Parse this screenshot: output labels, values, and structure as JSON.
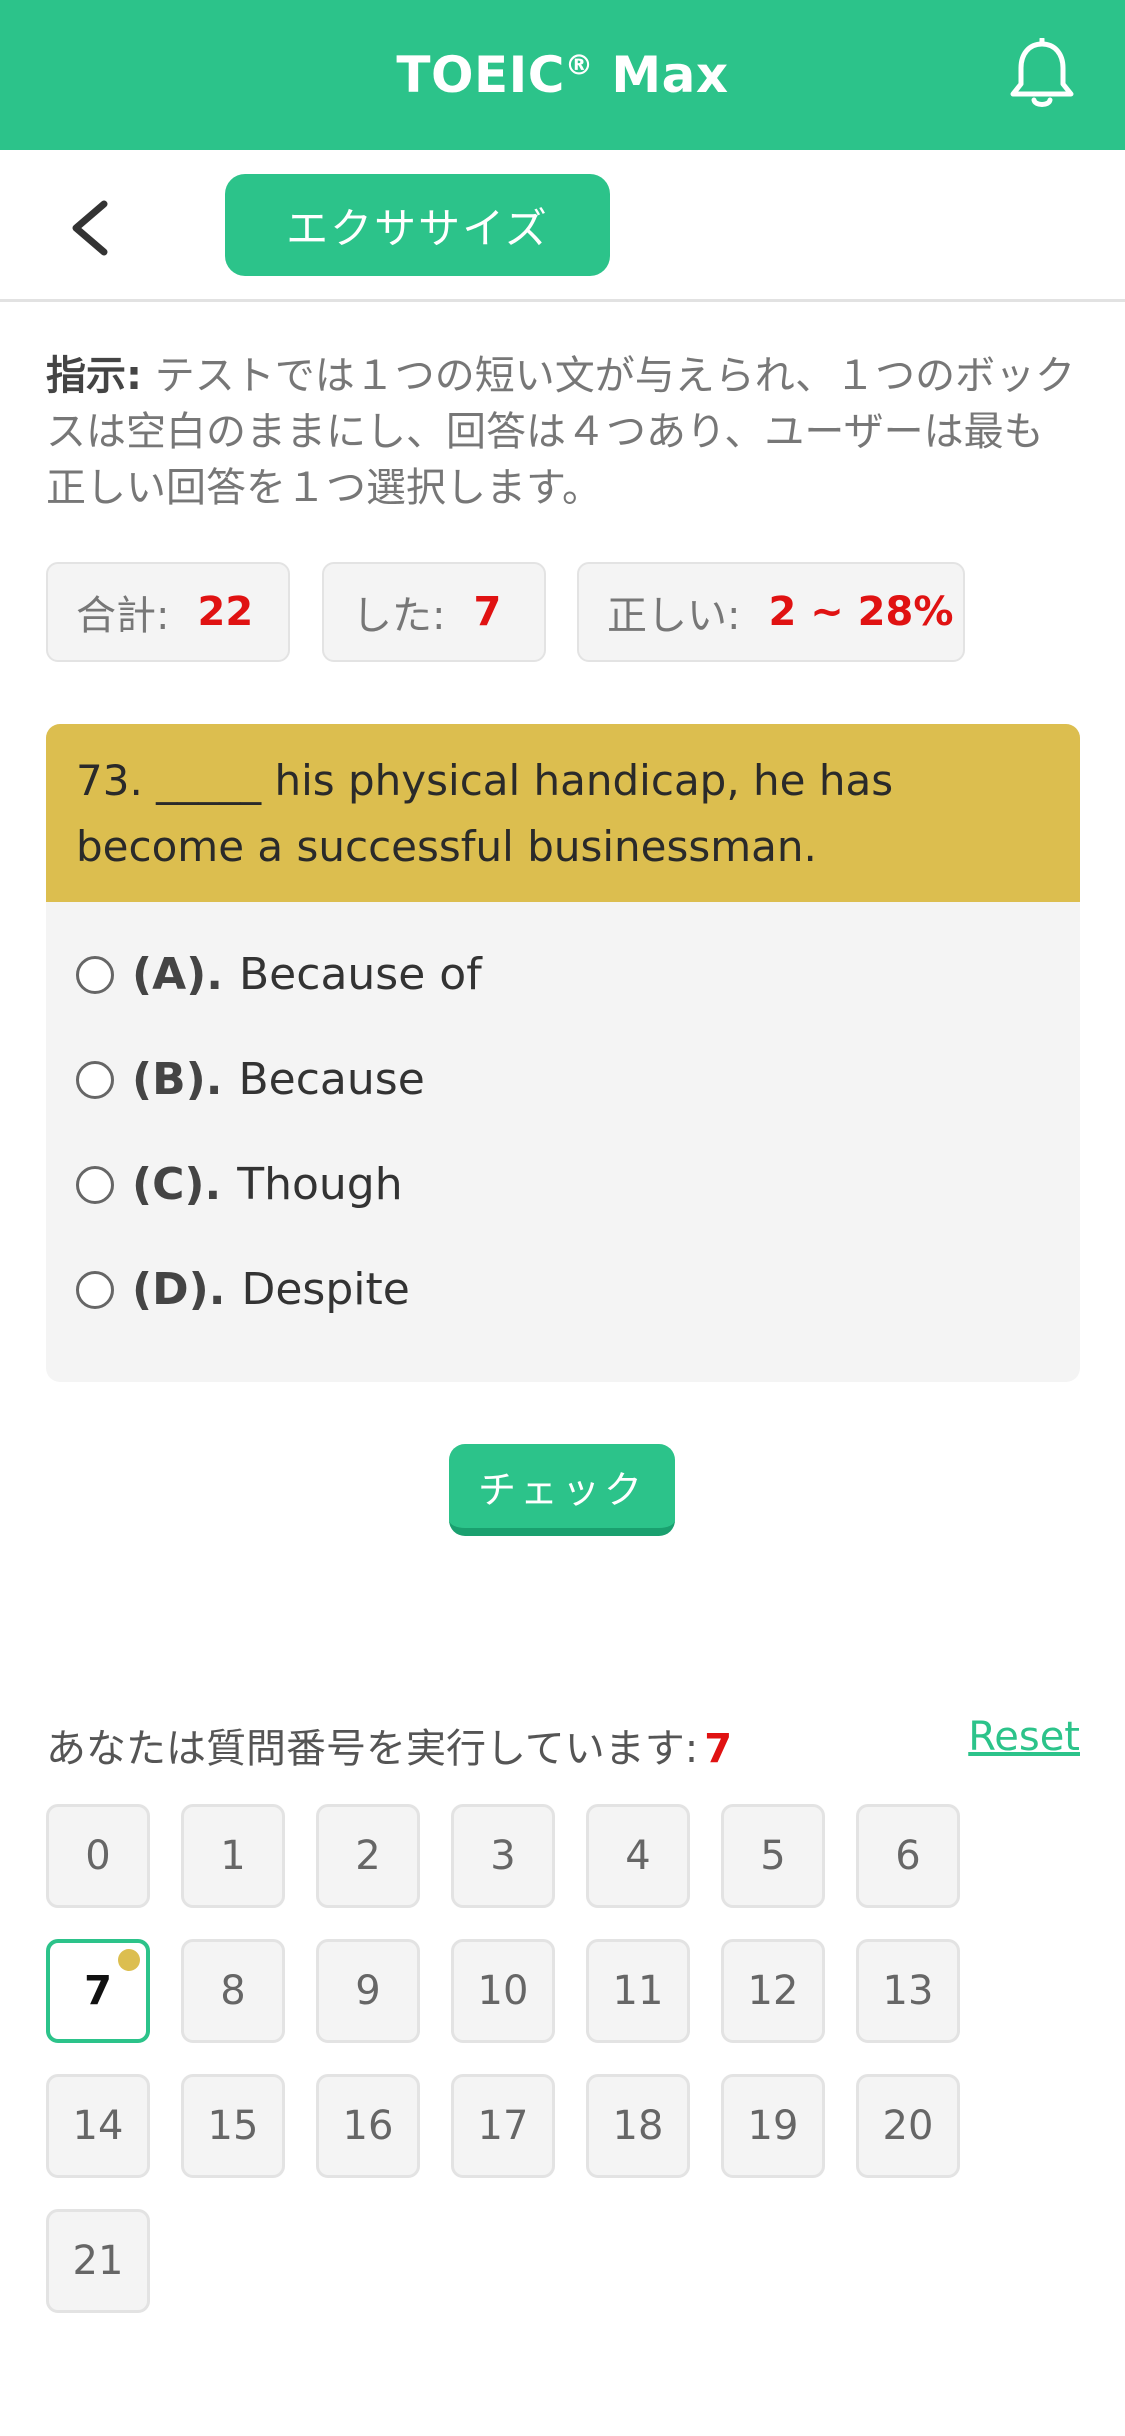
{
  "header": {
    "title": "TOEIC",
    "title_mark": "®",
    "title_suffix": " Max"
  },
  "subnav": {
    "tab_label": "エクササイズ"
  },
  "instruction": {
    "label": "指示:",
    "text": " テストでは１つの短い文が与えられ、１つのボックスは空白のままにし、回答は４つあり、ユーザーは最も正しい回答を１つ選択します。"
  },
  "stats": {
    "total_label": "合計:",
    "total_value": "22",
    "done_label": "した:",
    "done_value": "7",
    "correct_label": "正しい:",
    "correct_value": "2 ~ 28%"
  },
  "question": {
    "text": "73. _____ his physical handicap, he has become a successful businessman.",
    "options": [
      {
        "letter": "(A).",
        "text": "Because of"
      },
      {
        "letter": "(B).",
        "text": "Because"
      },
      {
        "letter": "(C).",
        "text": "Though"
      },
      {
        "letter": "(D).",
        "text": "Despite"
      }
    ]
  },
  "check_label": "チェック",
  "progress": {
    "label": "あなたは質問番号を実行しています:",
    "current": "7",
    "reset": "Reset"
  },
  "numbers": [
    "0",
    "1",
    "2",
    "3",
    "4",
    "5",
    "6",
    "7",
    "8",
    "9",
    "10",
    "11",
    "12",
    "13",
    "14",
    "15",
    "16",
    "17",
    "18",
    "19",
    "20",
    "21"
  ],
  "active_number": "7",
  "colors": {
    "brand": "#2cc38a",
    "question_bg": "#dcbe4f",
    "highlight": "#e01212"
  }
}
